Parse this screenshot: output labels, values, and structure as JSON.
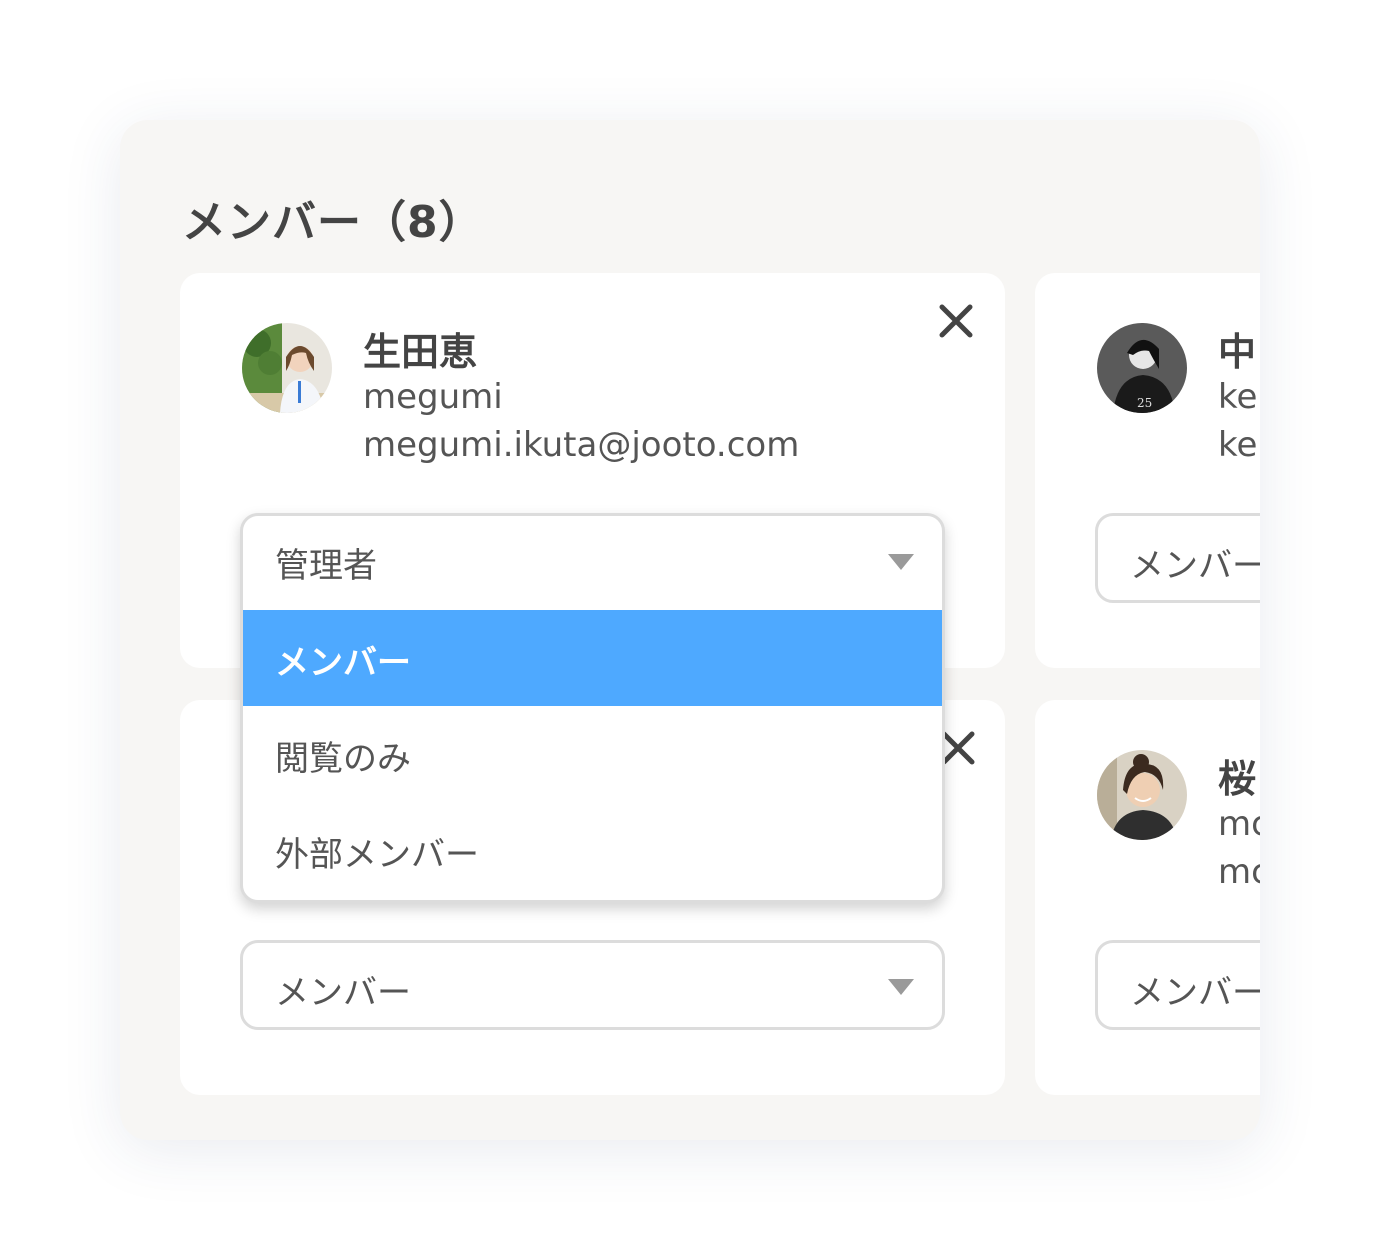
{
  "panel": {
    "title": "メンバー（8）"
  },
  "members": [
    {
      "name": "生田恵",
      "username": "megumi",
      "email": "megumi.ikuta@jooto.com",
      "role": "管理者"
    },
    {
      "name": "中",
      "username": "ke",
      "email": "ke",
      "role": "メンバー"
    },
    {
      "name": "",
      "username": "",
      "email": "",
      "role": "メンバー"
    },
    {
      "name": "桜",
      "username": "mc",
      "email": "mc",
      "role": "メンバー"
    }
  ],
  "role_dropdown": {
    "current": "管理者",
    "options": [
      {
        "label": "メンバー",
        "highlighted": true
      },
      {
        "label": "閲覧のみ",
        "highlighted": false
      },
      {
        "label": "外部メンバー",
        "highlighted": false
      }
    ]
  },
  "colors": {
    "highlight": "#4ea9ff",
    "panel_background": "#f7f6f4",
    "text": "#444444"
  },
  "icons": {
    "close": "close-icon",
    "caret": "caret-down-icon"
  }
}
